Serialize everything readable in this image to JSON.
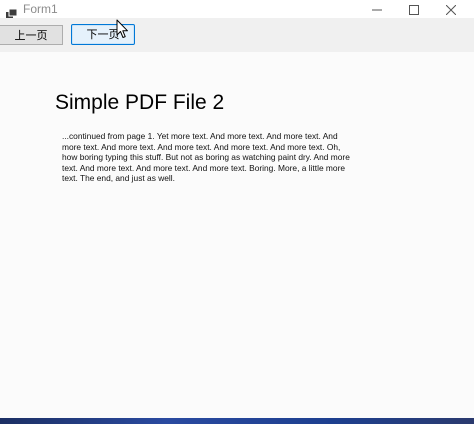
{
  "window": {
    "title": "Form1",
    "icon": "app-icon",
    "controls": [
      "minimize-icon",
      "maximize-icon",
      "close-icon"
    ]
  },
  "toolbar": {
    "prev_label": "上一页",
    "next_label": "下一页"
  },
  "pdf": {
    "title": "Simple PDF File 2",
    "body": "...continued from page 1. Yet more text. And more text. And more text. And more text. And more text. And more text. And more text. And more text. Oh, how boring typing this stuff. But not as boring as watching paint dry. And more text. And more text. And more text. And more text. Boring.  More, a little more text. The end, and just as well."
  },
  "colors": {
    "accent": "#0078d7",
    "button_bg": "#e1e1e1",
    "content_bg": "#fbfbfb"
  }
}
